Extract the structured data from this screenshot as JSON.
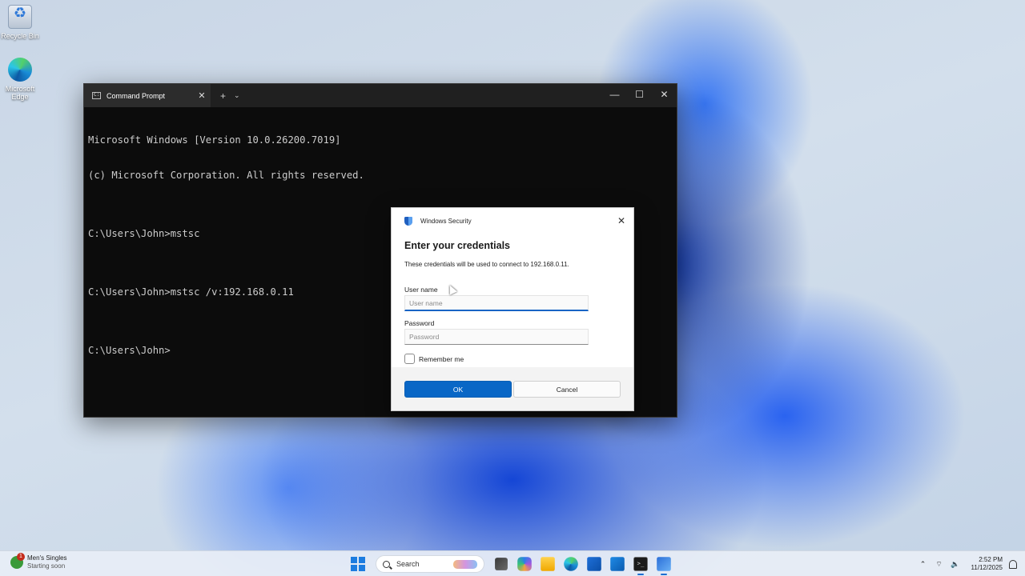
{
  "desktop": {
    "icons": [
      {
        "label": "Recycle Bin"
      },
      {
        "label": "Microsoft Edge"
      }
    ]
  },
  "terminal": {
    "tab_title": "Command Prompt",
    "tab_close": "✕",
    "new_tab": "+",
    "dropdown": "⌄",
    "minimize": "—",
    "maximize": "☐",
    "close": "✕",
    "lines": [
      "Microsoft Windows [Version 10.0.26200.7019]",
      "(c) Microsoft Corporation. All rights reserved.",
      "",
      "C:\\Users\\John>mstsc",
      "",
      "C:\\Users\\John>mstsc /v:192.168.0.11",
      "",
      "C:\\Users\\John>"
    ]
  },
  "dialog": {
    "header": "Windows Security",
    "close": "✕",
    "title": "Enter your credentials",
    "description": "These credentials will be used to connect to 192.168.0.11.",
    "username_label": "User name",
    "username_placeholder": "User name",
    "username_value": "",
    "password_label": "Password",
    "password_placeholder": "Password",
    "password_value": "",
    "remember_label": "Remember me",
    "remember_checked": false,
    "ok_label": "OK",
    "cancel_label": "Cancel"
  },
  "taskbar": {
    "widget_title": "Men's Singles",
    "widget_subtitle": "Starting soon",
    "widget_badge": "1",
    "search_placeholder": "Search",
    "apps": [
      "task-view",
      "copilot",
      "file-explorer",
      "edge",
      "microsoft-store",
      "outlook",
      "terminal",
      "remote-desktop"
    ],
    "tray": {
      "chevron": "⌃",
      "wifi": "⌔",
      "volume": "🔈",
      "time": "2:52 PM",
      "date": "11/12/2025"
    }
  }
}
